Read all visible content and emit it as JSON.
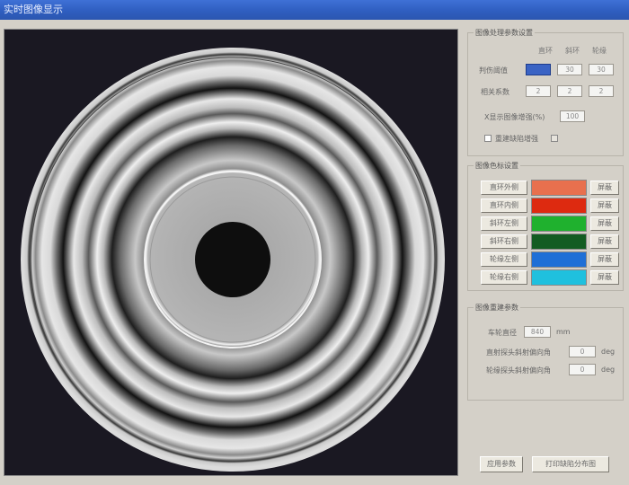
{
  "window": {
    "title": "实时图像显示"
  },
  "image_params": {
    "title": "图像处理参数设置",
    "columns": [
      "直环",
      "斜环",
      "轮缘"
    ],
    "rows": [
      {
        "label": "判伤阈值",
        "values": [
          "",
          "30",
          "30"
        ]
      },
      {
        "label": "相关系数",
        "values": [
          "2",
          "2",
          "2"
        ]
      }
    ],
    "gain_label": "X显示图像增强(%)",
    "gain_value": "100",
    "checkbox1_label": "重建缺陷增强",
    "checkbox2_label": ""
  },
  "color_settings": {
    "title": "图像色标设置",
    "items": [
      {
        "label": "直环外侧",
        "color": "#e8704e",
        "mask_label": "屏蔽"
      },
      {
        "label": "直环内侧",
        "color": "#dd2a10",
        "mask_label": "屏蔽"
      },
      {
        "label": "斜环左侧",
        "color": "#1fb12e",
        "mask_label": "屏蔽"
      },
      {
        "label": "斜环右侧",
        "color": "#135c22",
        "mask_label": "屏蔽"
      },
      {
        "label": "轮缘左侧",
        "color": "#1f6fd6",
        "mask_label": "屏蔽"
      },
      {
        "label": "轮缘右侧",
        "color": "#1fc0de",
        "mask_label": "屏蔽"
      }
    ]
  },
  "rebuild_params": {
    "title": "图像重建参数",
    "wheel_diameter_label": "车轮直径",
    "wheel_diameter_value": "840",
    "wheel_diameter_unit": "mm",
    "angle1_label": "直射探头斜射偏向角",
    "angle1_value": "0",
    "angle1_unit": "deg",
    "angle2_label": "轮缘探头斜射偏向角",
    "angle2_value": "0",
    "angle2_unit": "deg"
  },
  "buttons": {
    "apply": "应用参数",
    "print": "打印缺陷分布图"
  }
}
